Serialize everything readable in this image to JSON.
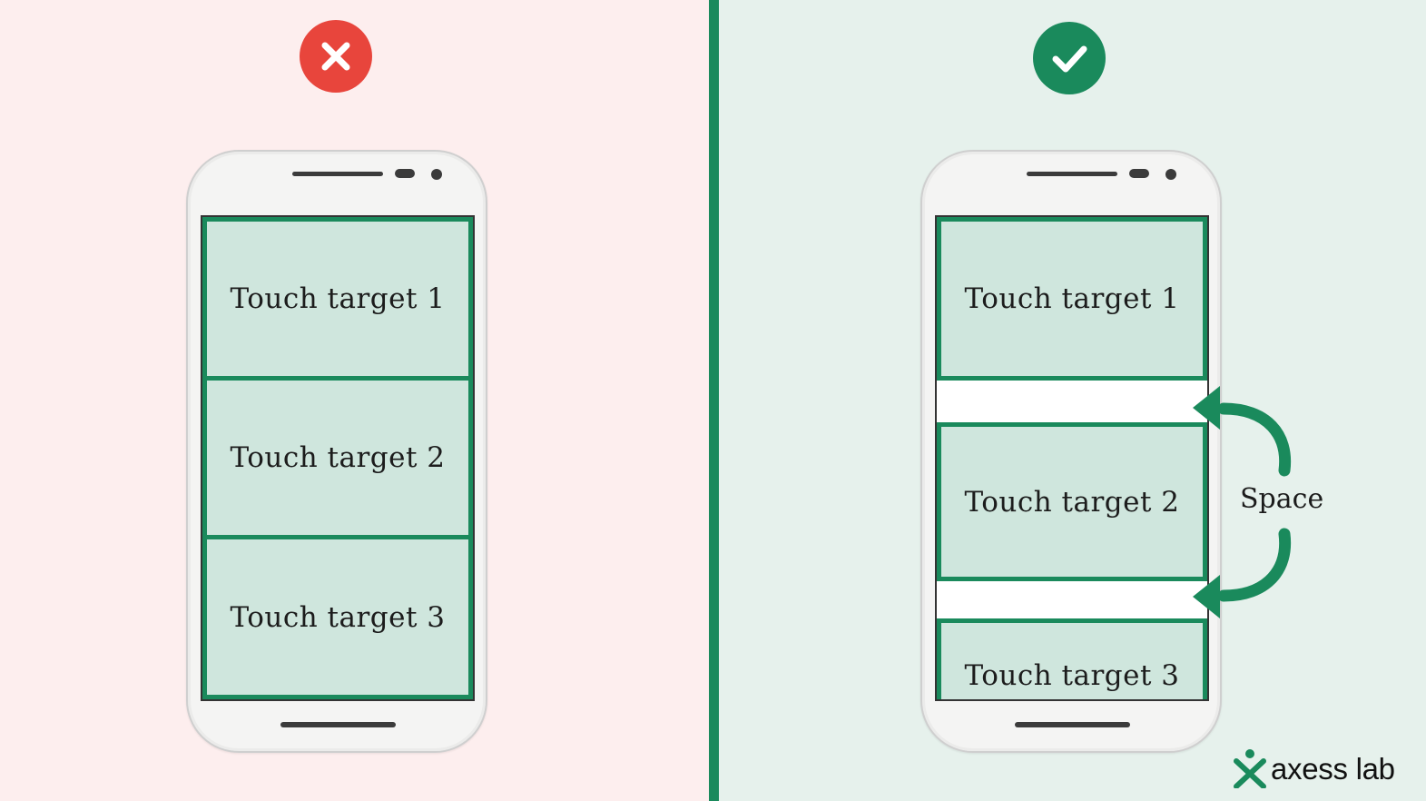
{
  "left_panel": {
    "icon": "x-mark-icon",
    "icon_color": "#e8453c",
    "targets": [
      {
        "label": "Touch target 1"
      },
      {
        "label": "Touch target 2"
      },
      {
        "label": "Touch target 3"
      }
    ]
  },
  "right_panel": {
    "icon": "checkmark-icon",
    "icon_color": "#1a8a5c",
    "targets": [
      {
        "label": "Touch target 1"
      },
      {
        "label": "Touch target 2"
      },
      {
        "label": "Touch target 3"
      }
    ],
    "space_label": "Space"
  },
  "colors": {
    "accent": "#1a8a5c",
    "target_fill": "#cfe6dd",
    "left_bg": "#fdeeee",
    "right_bg": "#e6f1ec"
  },
  "logo": {
    "text": "axess lab",
    "icon": "person-x-icon"
  }
}
